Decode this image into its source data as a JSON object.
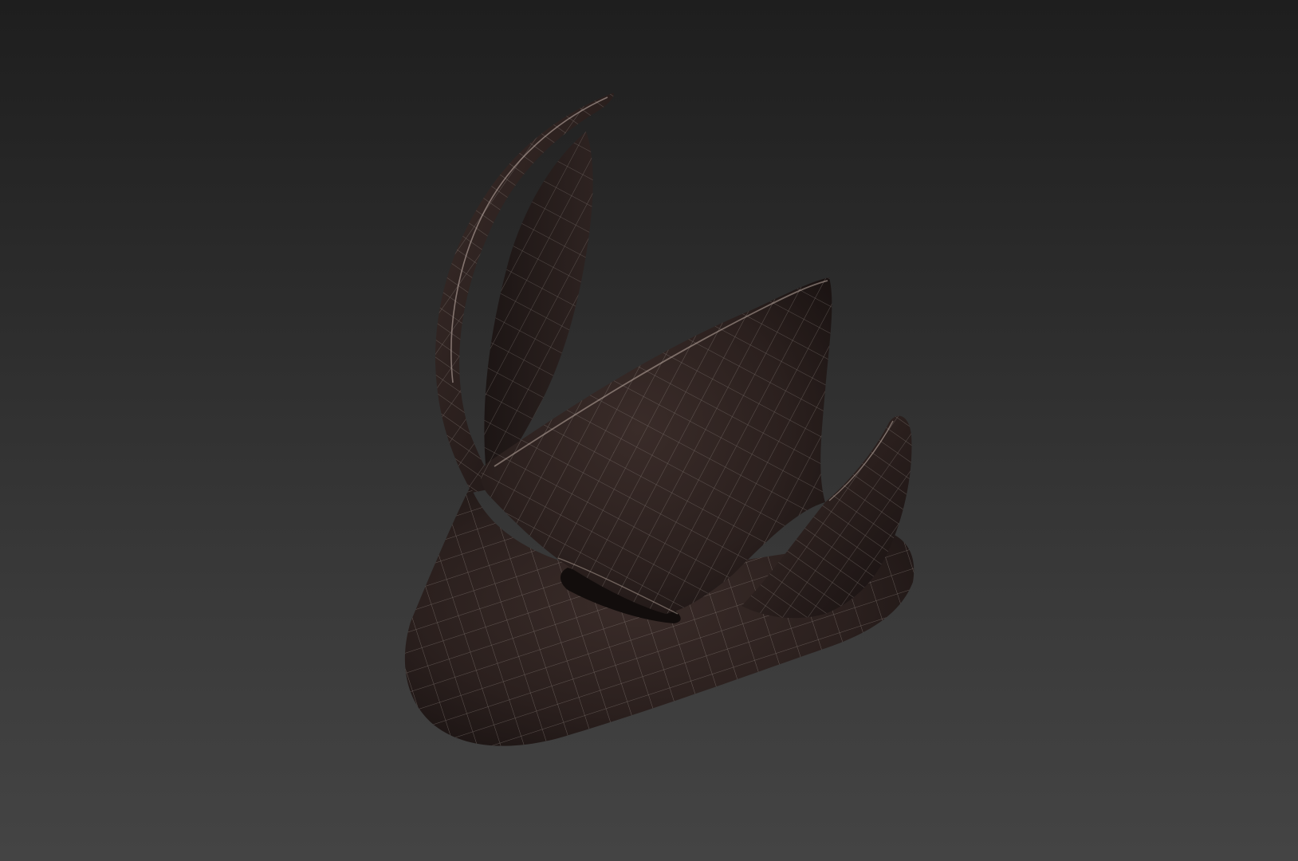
{
  "viewport": {
    "background_top": "#1e1e1e",
    "background_bottom": "#444444",
    "object_color": "#2e2220",
    "wire_color": "#8f8580",
    "highlight_color": "#c9b7ae",
    "display_mode": "shaded-with-wireframe",
    "object_icon": "3d-mesh-icon"
  }
}
